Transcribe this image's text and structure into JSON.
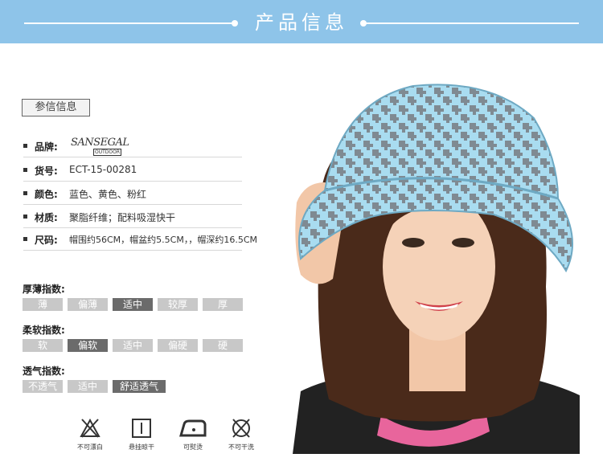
{
  "banner": {
    "title": "产品信息"
  },
  "params_tag": "参信信息",
  "specs": [
    {
      "label": "品牌:",
      "value": ""
    },
    {
      "label": "货号:",
      "value": "ECT-15-00281"
    },
    {
      "label": "颜色:",
      "value": "蓝色、黄色、粉红"
    },
    {
      "label": "材质:",
      "value": "聚脂纤维；配料吸湿快干"
    },
    {
      "label": "尺码:",
      "value": "帽围约56CM，帽盆约5.5CM，，帽深约16.5CM"
    }
  ],
  "brand_logo": {
    "main": "SANSEGAL",
    "sub": "OUTDOOR"
  },
  "scales": [
    {
      "title": "厚薄指数:",
      "options": [
        "薄",
        "偏薄",
        "适中",
        "较厚",
        "厚"
      ],
      "selected": "适中"
    },
    {
      "title": "柔软指数:",
      "options": [
        "软",
        "偏软",
        "适中",
        "偏硬",
        "硬"
      ],
      "selected": "偏软"
    },
    {
      "title": "透气指数:",
      "options": [
        "不透气",
        "适中",
        "舒适透气"
      ],
      "selected": "舒适透气"
    }
  ],
  "care": [
    {
      "icon": "no-bleach-icon",
      "label": "不可漂白"
    },
    {
      "icon": "hang-dry-icon",
      "label": "悬挂晾干"
    },
    {
      "icon": "iron-icon",
      "label": "可熨烫"
    },
    {
      "icon": "no-dry-clean-icon",
      "label": "不可干洗"
    }
  ],
  "colors": {
    "banner": "#8ec4e9",
    "scale_on": "#6b6b6b",
    "scale_off": "#c8c8c8",
    "hat": "#9ccfe3"
  }
}
